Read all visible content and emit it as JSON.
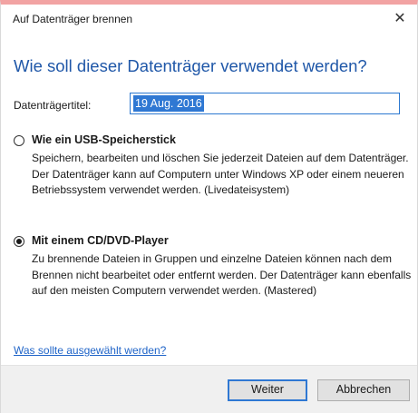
{
  "window": {
    "title": "Auf Datenträger brennen",
    "close_glyph": "✕",
    "close_icon": "close-icon"
  },
  "heading": "Wie soll dieser Datenträger verwendet werden?",
  "disc_title": {
    "label": "Datenträgertitel:",
    "value": "19 Aug. 2016"
  },
  "options": [
    {
      "label": "Wie ein USB-Speicherstick",
      "description": "Speichern, bearbeiten und löschen Sie jederzeit Dateien auf dem Datenträger. Der Datenträger kann auf Computern unter Windows XP oder einem neueren Betriebssystem verwendet werden. (Livedateisystem)",
      "selected": false
    },
    {
      "label": "Mit einem CD/DVD-Player",
      "description": "Zu brennende Dateien in Gruppen und einzelne Dateien können nach dem Brennen nicht bearbeitet oder entfernt werden. Der Datenträger kann ebenfalls auf den meisten Computern verwendet werden. (Mastered)",
      "selected": true
    }
  ],
  "help_link": "Was sollte ausgewählt werden?",
  "buttons": {
    "next": "Weiter",
    "cancel": "Abbrechen"
  },
  "colors": {
    "heading": "#1f57a8",
    "link": "#1f64c8",
    "selection": "#2f78d3",
    "titlebar_accent": "#f2a3a3",
    "footer": "#f0f0f0"
  }
}
